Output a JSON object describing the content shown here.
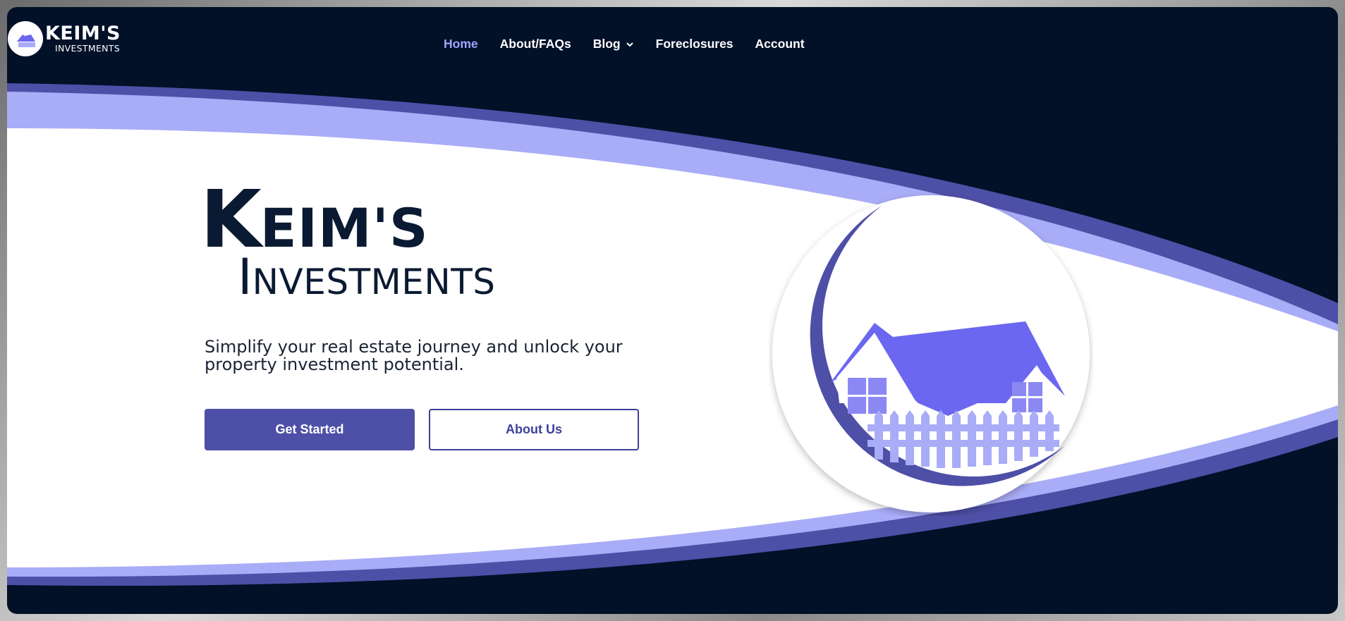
{
  "brand": {
    "logo_title": "KEIM'S",
    "logo_subtitle": "INVESTMENTS"
  },
  "nav": {
    "items": [
      {
        "label": "Home",
        "active": true
      },
      {
        "label": "About/FAQs",
        "active": false
      },
      {
        "label": "Blog",
        "active": false,
        "has_dropdown": true
      },
      {
        "label": "Foreclosures",
        "active": false
      },
      {
        "label": "Account",
        "active": false
      }
    ]
  },
  "hero": {
    "title_initial": "K",
    "title_rest": "EIM'S",
    "subtitle_initial": "I",
    "subtitle_rest": "NVESTMENTS",
    "tagline": "Simplify your real estate journey and unlock your property investment potential.",
    "primary_button": "Get Started",
    "secondary_button": "About Us"
  },
  "colors": {
    "navy": "#021028",
    "accent": "#4e4fa6",
    "light_accent": "#a9acf7",
    "roof": "#6b67f0",
    "active_nav": "#9ea5ff"
  },
  "icons": {
    "logo": "house-moon-logo-icon",
    "hero_image": "house-moon-illustration",
    "dropdown": "chevron-down-icon"
  }
}
